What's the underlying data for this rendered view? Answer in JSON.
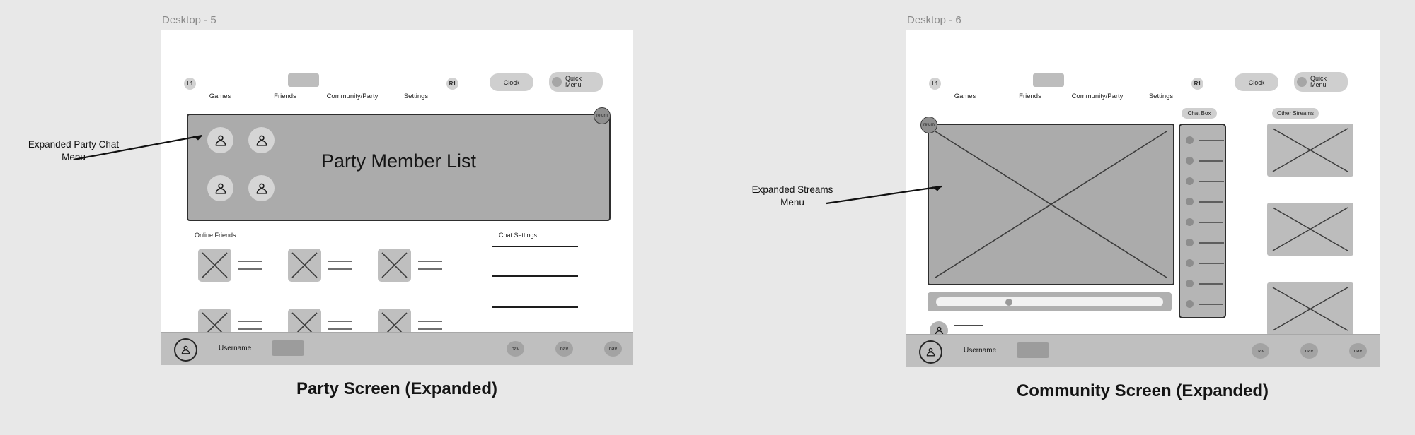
{
  "meta": {
    "canvas_bg": "#e8e8e8",
    "panel_gray": "#ababab",
    "accent_dark": "#2e2e2e"
  },
  "frames": [
    {
      "id": "party",
      "label": "Desktop - 5",
      "caption": "Party Screen (Expanded)",
      "topnav": {
        "left_shoulder": "L1",
        "right_shoulder": "R1",
        "items": [
          {
            "label": "Games"
          },
          {
            "label": "Friends"
          },
          {
            "label": "Community/Party"
          },
          {
            "label": "Settings"
          }
        ],
        "clock_label": "Clock",
        "quick_menu_line1": "Quick",
        "quick_menu_line2": "Menu"
      },
      "expanded": {
        "title": "Party Member List",
        "return_label": "return",
        "member_count": 4
      },
      "online_friends_label": "Online Friends",
      "chat_settings_label": "Chat Settings",
      "friend_tiles": 6,
      "chat_setting_rules": 4,
      "bottombar": {
        "username": "Username",
        "nav_labels": [
          "nav",
          "nav",
          "nav"
        ]
      }
    },
    {
      "id": "community",
      "label": "Desktop - 6",
      "caption": "Community Screen (Expanded)",
      "topnav": {
        "left_shoulder": "L1",
        "right_shoulder": "R1",
        "items": [
          {
            "label": "Games"
          },
          {
            "label": "Friends"
          },
          {
            "label": "Community/Party"
          },
          {
            "label": "Settings"
          }
        ],
        "clock_label": "Clock",
        "quick_menu_line1": "Quick",
        "quick_menu_line2": "Menu"
      },
      "stream": {
        "return_label": "return"
      },
      "chat_box_label": "Chat Box",
      "other_streams_label": "Other Streams",
      "chat_rows": 9,
      "thumbnails": 3,
      "bottombar": {
        "username": "Username",
        "nav_labels": [
          "nav",
          "nav",
          "nav"
        ]
      }
    }
  ],
  "annotations": [
    {
      "id": "party-anno",
      "text": "Expanded Party Chat\nMenu"
    },
    {
      "id": "streams-anno",
      "text": "Expanded Streams\nMenu"
    }
  ]
}
